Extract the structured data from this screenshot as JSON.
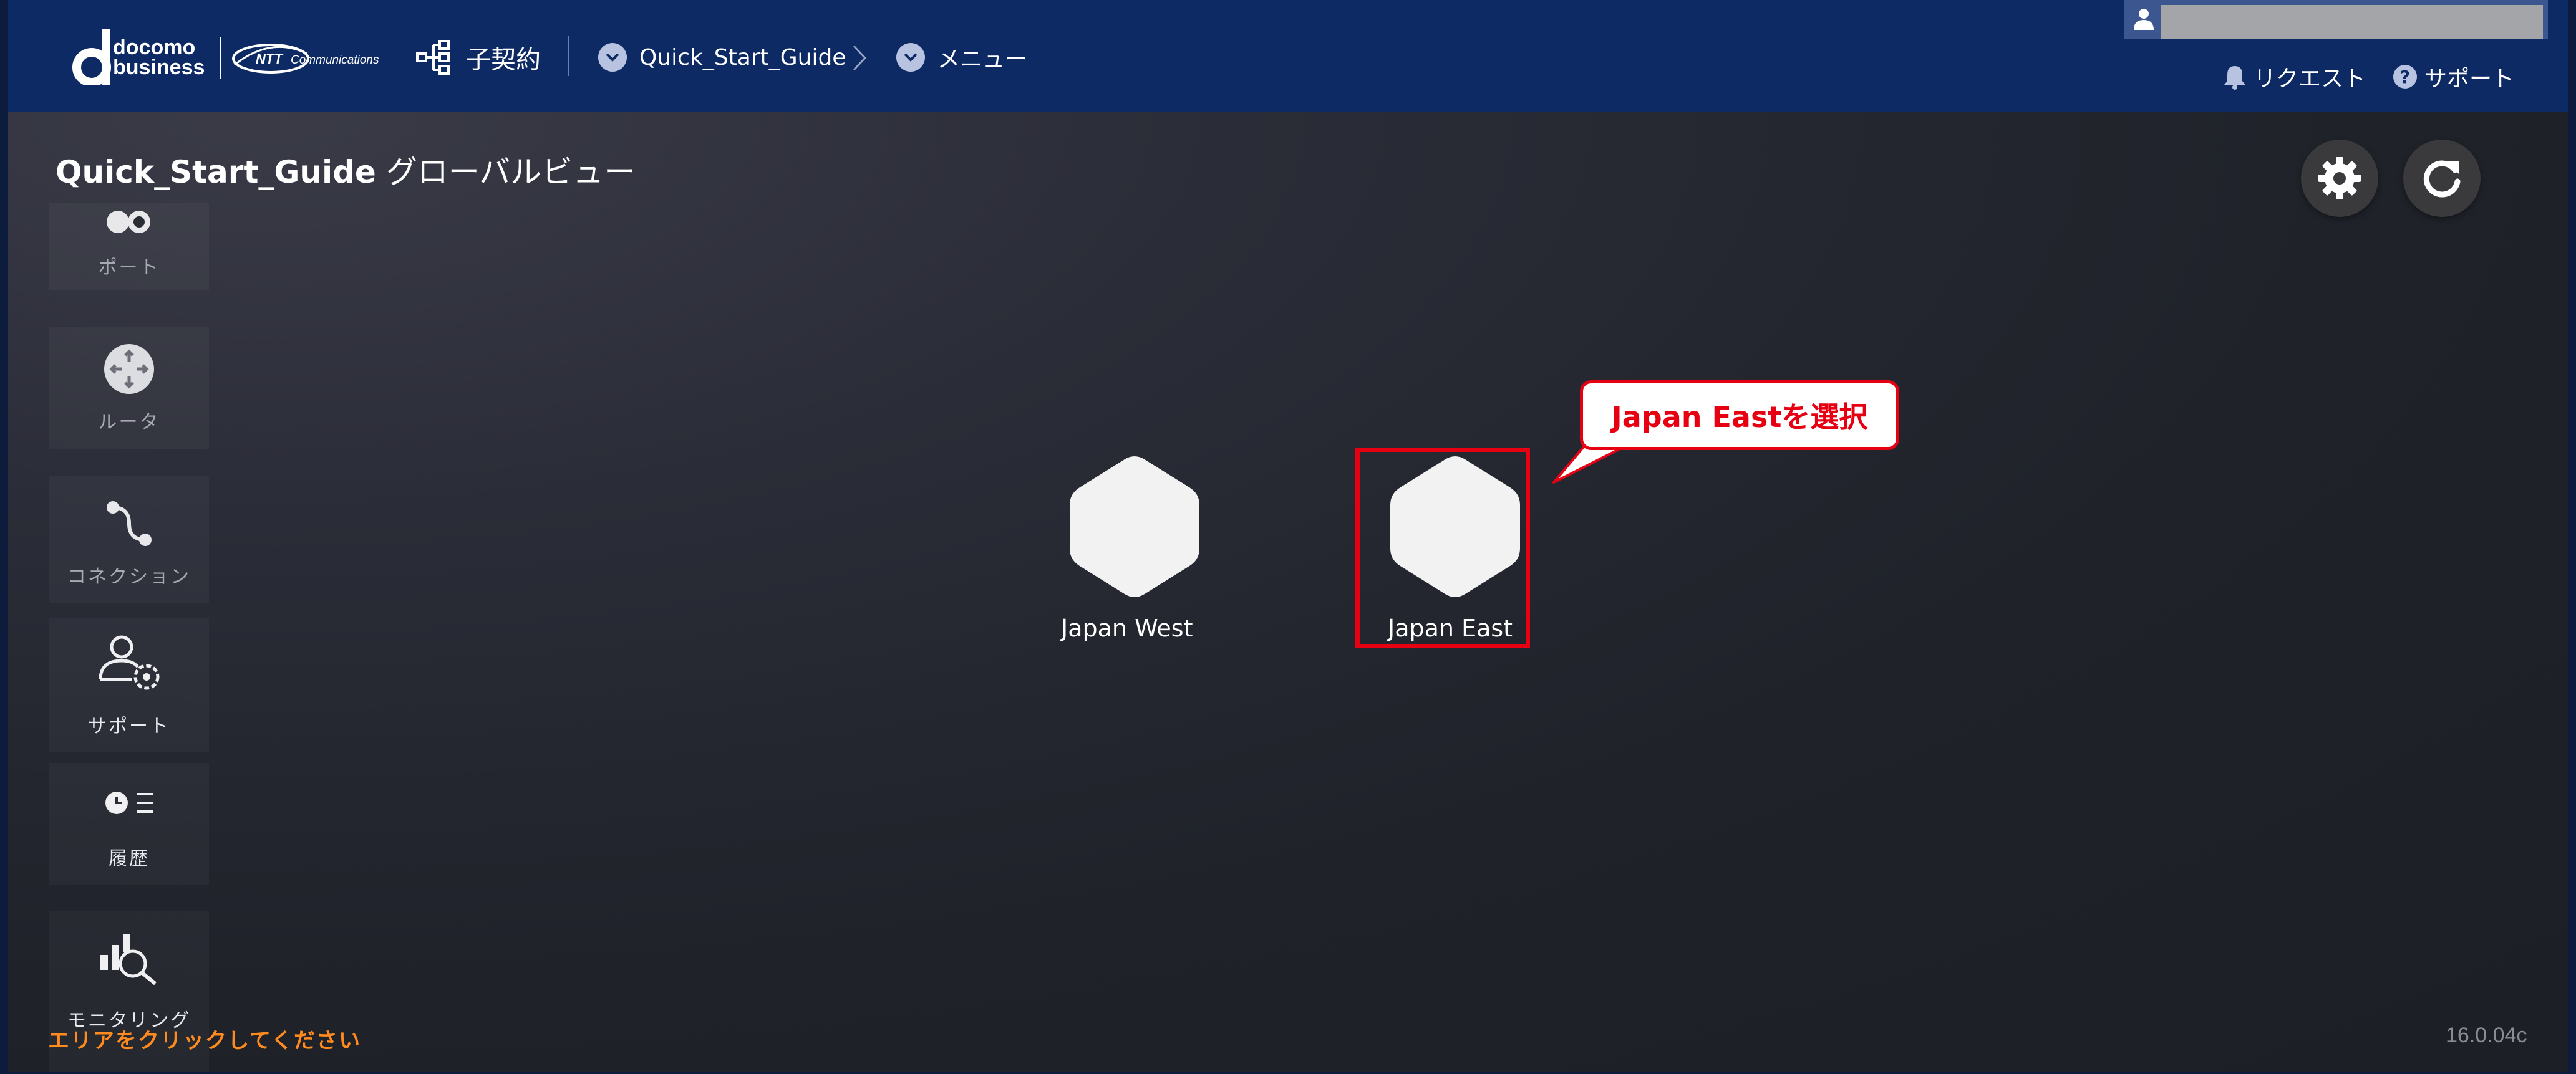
{
  "header": {
    "logo": {
      "line1": "docomo",
      "line2": "business",
      "ntt": "NTT Communications"
    },
    "contract_label": "子契約",
    "breadcrumb": [
      {
        "label": "Quick_Start_Guide"
      },
      {
        "label": "メニュー"
      }
    ],
    "user_name": "",
    "links": {
      "request": "リクエスト",
      "support": "サポート"
    }
  },
  "page": {
    "title_bold": "Quick_Start_Guide",
    "title_rest": " グローバルビュー"
  },
  "sidebar": {
    "items": [
      {
        "label": "ポート",
        "icon": "port-icon"
      },
      {
        "label": "ルータ",
        "icon": "router-icon"
      },
      {
        "label": "コネクション",
        "icon": "connection-icon"
      },
      {
        "label": "サポート",
        "icon": "support-user-gear-icon"
      },
      {
        "label": "履歴",
        "icon": "history-icon"
      },
      {
        "label": "モニタリング",
        "icon": "monitoring-icon"
      }
    ]
  },
  "map": {
    "nodes": [
      {
        "label": "Japan West"
      },
      {
        "label": "Japan East"
      }
    ],
    "callout": "Japan Eastを選択"
  },
  "footer": {
    "hint": "エリアをクリックしてください",
    "version": "16.0.04c"
  },
  "colors": {
    "header_bg": "#0d2a64",
    "highlight": "#e60012",
    "hint": "#ff8a1e"
  }
}
